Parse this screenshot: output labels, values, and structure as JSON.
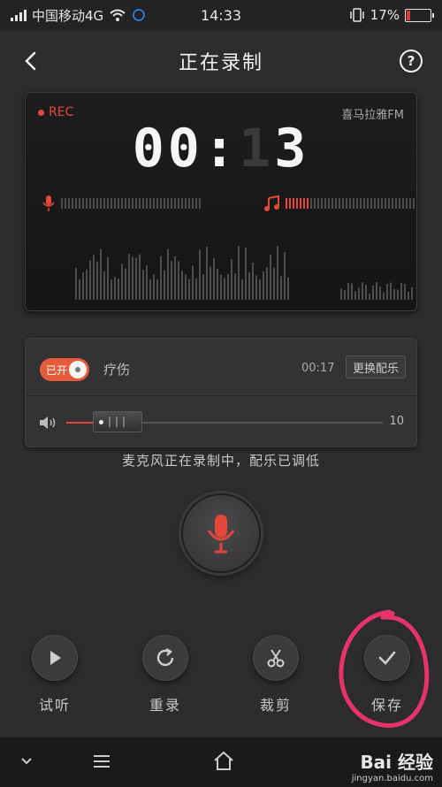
{
  "status": {
    "carrier": "中国移动4G",
    "time": "14:33",
    "battery": "17%",
    "battery_level": 0.17
  },
  "header": {
    "title": "正在录制",
    "help_label": "?"
  },
  "recorder": {
    "rec_label": "REC",
    "brand": "喜马拉雅FM",
    "timer_minutes": "00",
    "timer_sep": ":",
    "timer_tens": "1",
    "timer_ones": "3",
    "music_meter_level": 0.18,
    "colors": {
      "accent": "#e5473a",
      "display_bg": "#1a1a1b"
    }
  },
  "music": {
    "toggle_label": "已开",
    "song_title": "疗伤",
    "duration": "00:17",
    "change_button": "更换配乐",
    "volume_value": "10",
    "volume_level": 0.1
  },
  "hint": "麦克风正在录制中，配乐已调低",
  "actions": [
    {
      "label": "试听",
      "icon": "play-icon"
    },
    {
      "label": "重录",
      "icon": "rerecord-icon"
    },
    {
      "label": "裁剪",
      "icon": "scissors-icon"
    },
    {
      "label": "保存",
      "icon": "check-icon"
    }
  ],
  "watermark": {
    "line1": "Bai 经验",
    "line2": "jingyan.baidu.com"
  }
}
